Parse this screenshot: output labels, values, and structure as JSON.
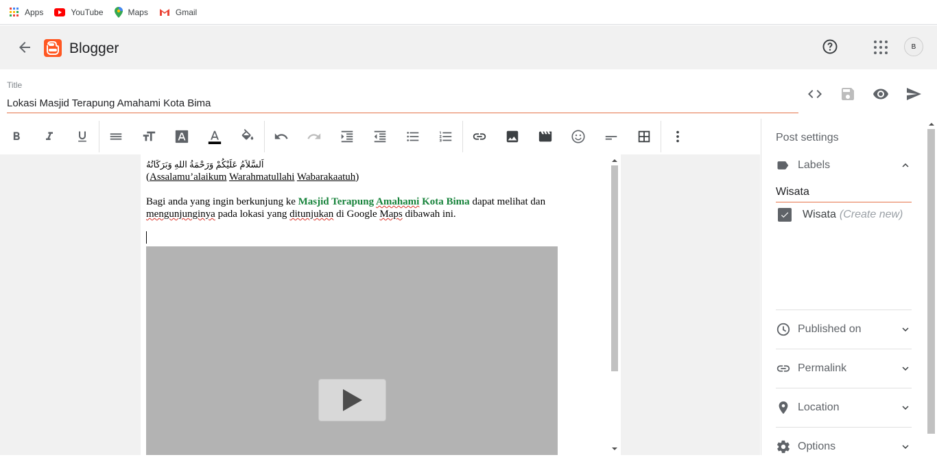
{
  "bookmarks": [
    {
      "label": "Apps",
      "icon": "apps-grid-icon"
    },
    {
      "label": "YouTube",
      "icon": "youtube-icon"
    },
    {
      "label": "Maps",
      "icon": "maps-pin-icon"
    },
    {
      "label": "Gmail",
      "icon": "gmail-icon"
    }
  ],
  "appbar": {
    "brand": "Blogger",
    "avatar_text": "B"
  },
  "post": {
    "title_label": "Title",
    "title_value": "Lokasi Masjid Terapung Amahami Kota Bima"
  },
  "toolbar": {
    "items": [
      "bold",
      "italic",
      "underline",
      "format",
      "font-size",
      "highlight-text",
      "text-color",
      "fill-color",
      "undo",
      "redo",
      "indent",
      "outdent",
      "bulleted-list",
      "numbered-list",
      "link",
      "image",
      "video",
      "emoji",
      "separator",
      "table",
      "more"
    ]
  },
  "content": {
    "arabic": "اَلسَّلاَمُ عَلَيْكُمْ وَرَحْمَةُ اللهِ وَبَرَكَاتُهُ",
    "greeting_open": "(",
    "greeting_w1": "Assalamu’alaikum",
    "greeting_w2": "Warahmatullahi",
    "greeting_w3": "Wabarakaatuh",
    "greeting_close": ")",
    "p1_a": "Bagi anda yang ingin berkunjung ke ",
    "p1_b1": "Masjid Terapung ",
    "p1_b2": "Amahami",
    "p1_b3": " Kota Bima",
    "p1_c": " dapat melihat dan",
    "p2_w1": "mengunjunginya",
    "p2_a": " pada lokasi yang ",
    "p2_w2": "ditunjukan",
    "p2_b": " di Google ",
    "p2_w3": "Maps",
    "p2_c": " dibawah ini."
  },
  "settings": {
    "title": "Post settings",
    "labels_title": "Labels",
    "label_input": "Wisata",
    "label_option": "Wisata",
    "create_new": "(Create new)",
    "published_on": "Published on",
    "permalink": "Permalink",
    "location": "Location",
    "options": "Options"
  },
  "colors": {
    "accent": "#e5734a",
    "brand": "#ff5722",
    "link_green": "#17833b"
  }
}
